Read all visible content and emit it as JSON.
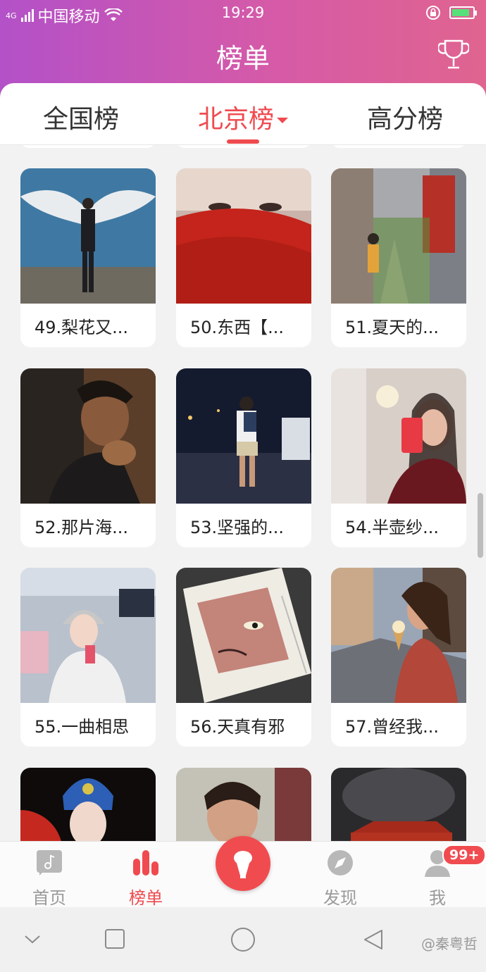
{
  "status_bar": {
    "network": "4G",
    "carrier": "中国移动",
    "time": "19:29"
  },
  "header": {
    "title": "榜单",
    "trophy_icon": "trophy-icon"
  },
  "tabs": [
    {
      "label": "全国榜",
      "active": false
    },
    {
      "label": "北京榜",
      "active": true
    },
    {
      "label": "高分榜",
      "active": false
    }
  ],
  "cards": [
    {
      "label": "49.梨花又...",
      "icon": "photo-man-angel-wings"
    },
    {
      "label": "50.东西【...",
      "icon": "photo-woman-red-petals"
    },
    {
      "label": "51.夏天的...",
      "icon": "photo-hutong-street"
    },
    {
      "label": "52.那片海...",
      "icon": "photo-young-man-dark"
    },
    {
      "label": "53.坚强的...",
      "icon": "photo-night-street"
    },
    {
      "label": "54.半壶纱...",
      "icon": "photo-woman-mirror-selfie"
    },
    {
      "label": "55.一曲相思",
      "icon": "photo-girl-restaurant"
    },
    {
      "label": "56.天真有邪",
      "icon": "photo-anime-book"
    },
    {
      "label": "57.曾经我...",
      "icon": "photo-woman-ice-cream"
    },
    {
      "label": "",
      "icon": "photo-opera-costume"
    },
    {
      "label": "",
      "icon": "photo-woman-selfie"
    },
    {
      "label": "",
      "icon": "photo-red-car"
    }
  ],
  "bottom_nav": {
    "items": [
      {
        "label": "首页",
        "icon": "music-note-icon",
        "active": false
      },
      {
        "label": "榜单",
        "icon": "bar-chart-icon",
        "active": true
      },
      {
        "label": "",
        "icon": "microphone-icon",
        "active": false
      },
      {
        "label": "发现",
        "icon": "compass-icon",
        "active": false
      },
      {
        "label": "我",
        "icon": "person-icon",
        "active": false
      }
    ],
    "badge": "99+"
  },
  "system_bar": {
    "watermark": "@秦粤哲"
  },
  "colors": {
    "accent": "#ef4a4f",
    "header_start": "#b351c8",
    "header_end": "#e0648f"
  }
}
